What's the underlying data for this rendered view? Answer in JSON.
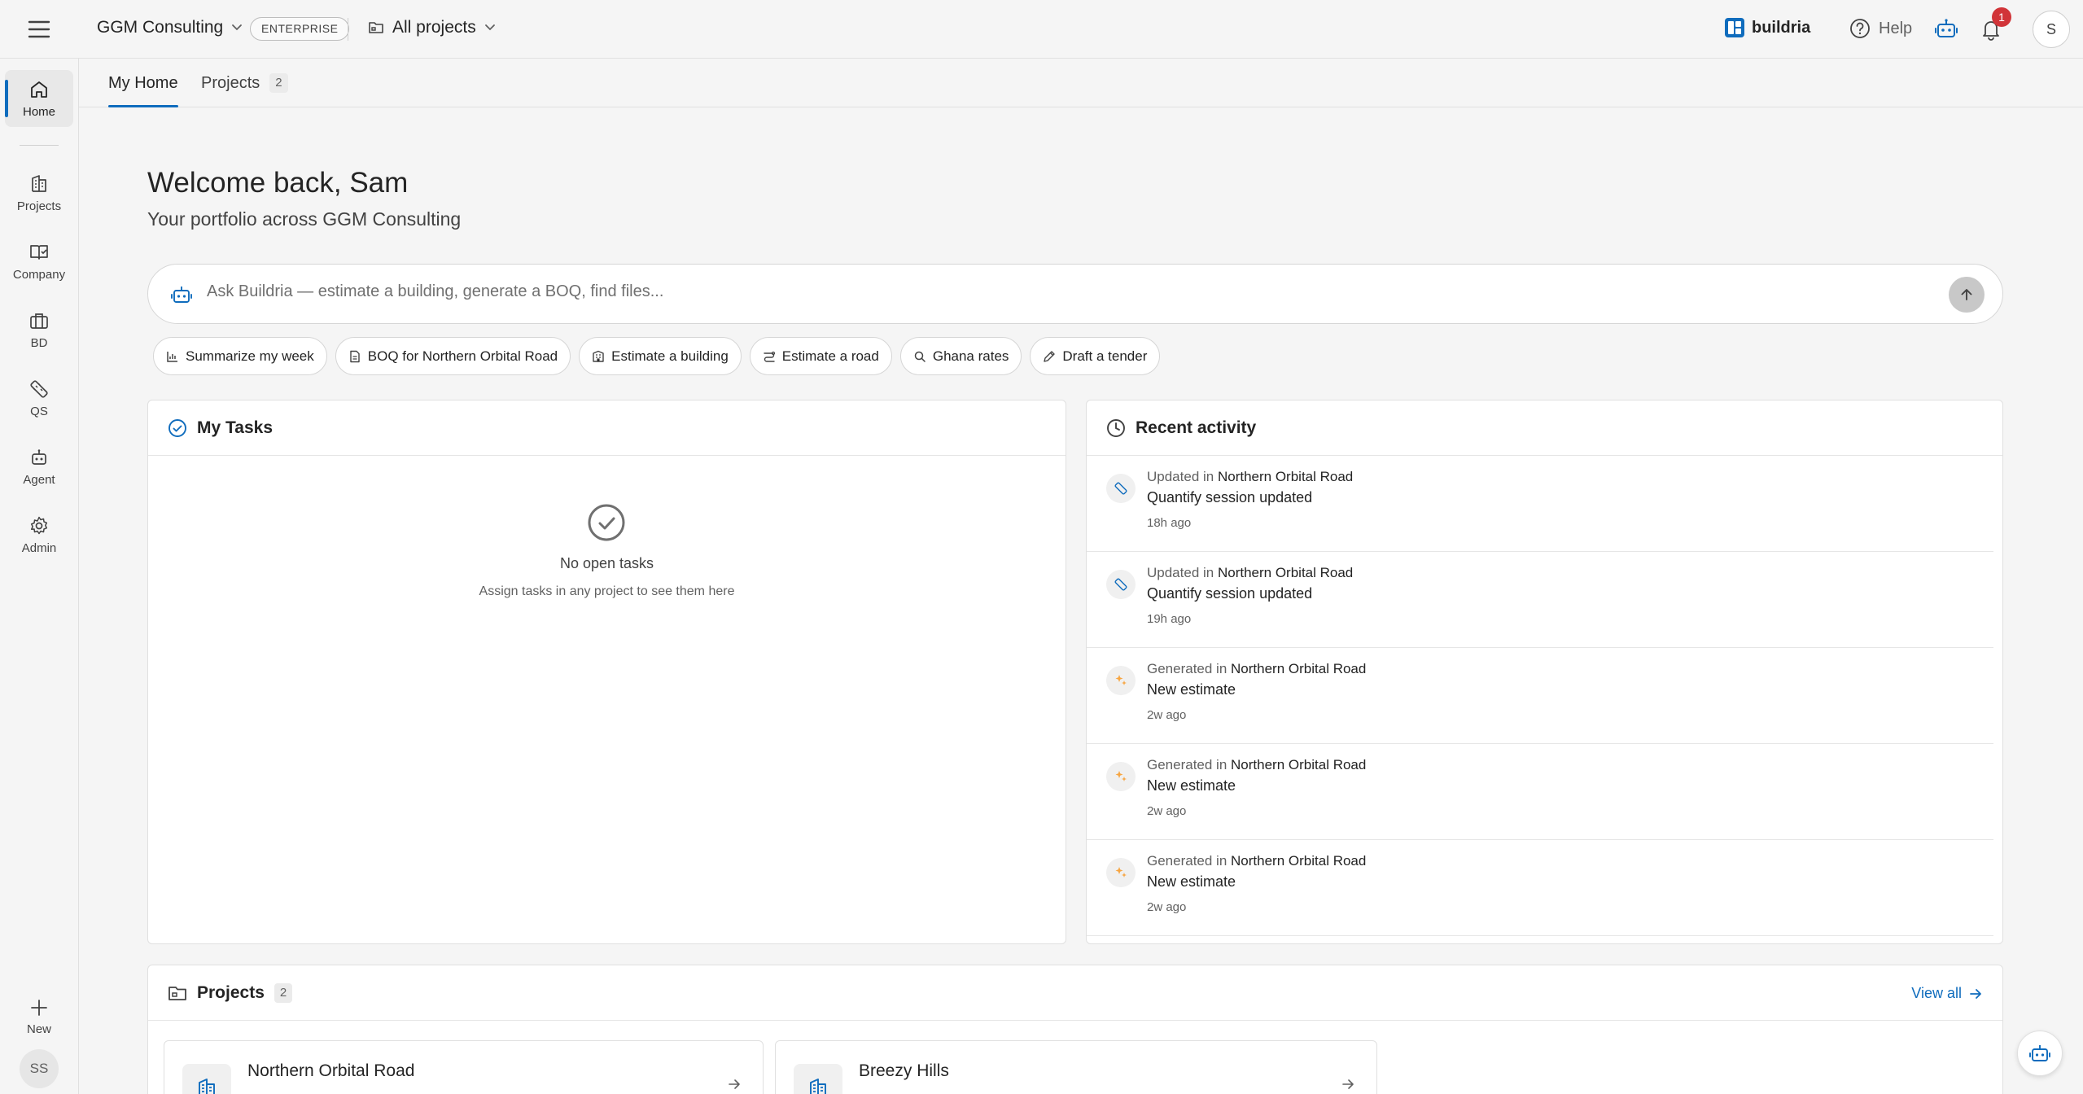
{
  "topbar": {
    "org_name": "GGM Consulting",
    "plan_badge": "ENTERPRISE",
    "project_scope": "All projects",
    "brand_name": "buildria",
    "help_label": "Help",
    "notification_count": "1",
    "user_initial": "S"
  },
  "sidebar": {
    "items": [
      {
        "label": "Home",
        "icon": "home-icon"
      },
      {
        "label": "Projects",
        "icon": "building-icon"
      },
      {
        "label": "Company",
        "icon": "book-icon"
      },
      {
        "label": "BD",
        "icon": "briefcase-icon"
      },
      {
        "label": "QS",
        "icon": "ruler-icon"
      },
      {
        "label": "Agent",
        "icon": "bot-icon"
      },
      {
        "label": "Admin",
        "icon": "gear-icon"
      }
    ],
    "new_label": "New",
    "user_initials": "SS"
  },
  "tabs": {
    "home_label": "My Home",
    "projects_label": "Projects",
    "projects_count": "2"
  },
  "welcome": {
    "title": "Welcome back, Sam",
    "subtitle": "Your portfolio across GGM Consulting"
  },
  "ask": {
    "placeholder": "Ask Buildria — estimate a building, generate a BOQ, find files..."
  },
  "chips": [
    {
      "label": "Summarize my week",
      "icon": "chart-icon"
    },
    {
      "label": "BOQ for Northern Orbital Road",
      "icon": "document-icon"
    },
    {
      "label": "Estimate a building",
      "icon": "building-icon"
    },
    {
      "label": "Estimate a road",
      "icon": "road-icon"
    },
    {
      "label": "Ghana rates",
      "icon": "search-icon"
    },
    {
      "label": "Draft a tender",
      "icon": "pen-icon"
    }
  ],
  "tasks": {
    "title": "My Tasks",
    "empty_title": "No open tasks",
    "empty_subtitle": "Assign tasks in any project to see them here"
  },
  "activity": {
    "title": "Recent activity",
    "items": [
      {
        "verb": "Updated in",
        "project": "Northern Orbital Road",
        "description": "Quantify session updated",
        "time": "18h ago",
        "icon": "ruler-icon"
      },
      {
        "verb": "Updated in",
        "project": "Northern Orbital Road",
        "description": "Quantify session updated",
        "time": "19h ago",
        "icon": "ruler-icon"
      },
      {
        "verb": "Generated in",
        "project": "Northern Orbital Road",
        "description": "New estimate",
        "time": "2w ago",
        "icon": "sparkle-icon"
      },
      {
        "verb": "Generated in",
        "project": "Northern Orbital Road",
        "description": "New estimate",
        "time": "2w ago",
        "icon": "sparkle-icon"
      },
      {
        "verb": "Generated in",
        "project": "Northern Orbital Road",
        "description": "New estimate",
        "time": "2w ago",
        "icon": "sparkle-icon"
      }
    ]
  },
  "projects": {
    "title": "Projects",
    "count": "2",
    "view_all": "View all",
    "items": [
      {
        "name": "Northern Orbital Road"
      },
      {
        "name": "Breezy Hills"
      }
    ]
  },
  "colors": {
    "accent": "#0f6cbd",
    "notification": "#d13438",
    "sparkle": "#f7a541"
  }
}
